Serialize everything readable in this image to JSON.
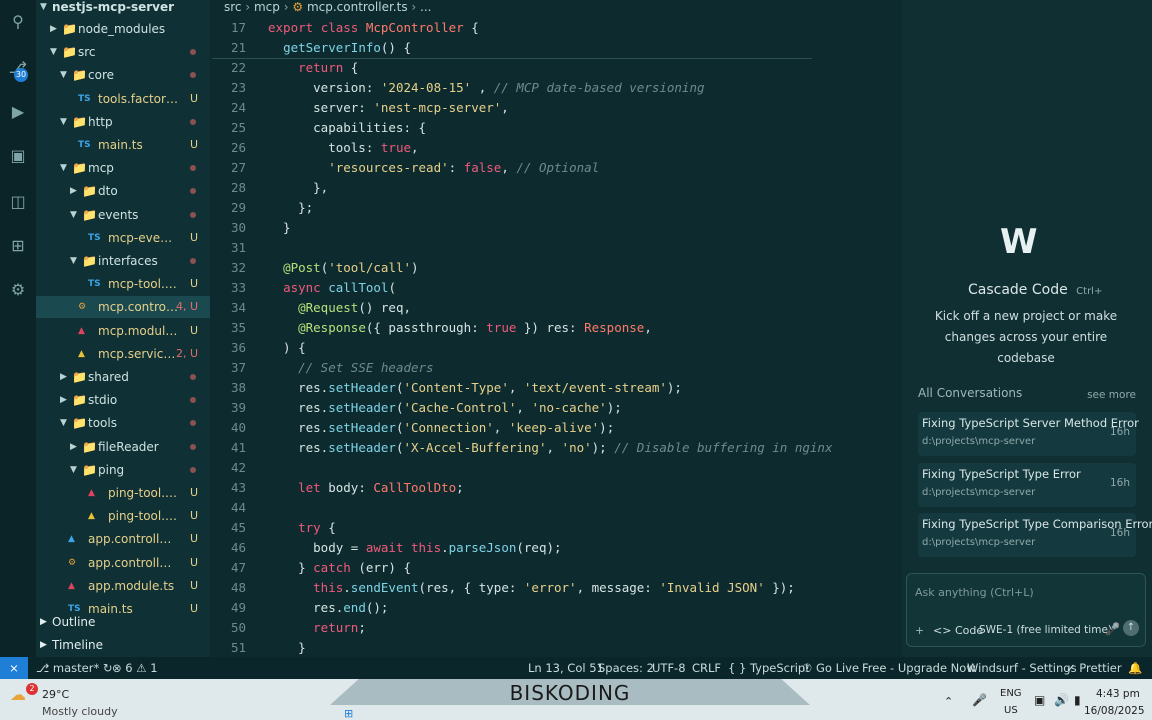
{
  "activity_bar": {
    "icons": [
      "search-icon",
      "source-control-icon",
      "run-debug-icon",
      "extensions-icon",
      "remote-explorer-icon",
      "testing-icon",
      "windsurf-icon"
    ],
    "scm_badge": "30"
  },
  "explorer": {
    "root": "nestjs-mcp-server",
    "items": [
      {
        "label": "node_modules",
        "depth": 1,
        "kind": "folder",
        "open": false,
        "status": ""
      },
      {
        "label": "src",
        "depth": 1,
        "kind": "folder",
        "open": true,
        "status": "dot"
      },
      {
        "label": "core",
        "depth": 2,
        "kind": "folder",
        "open": true,
        "status": "dot"
      },
      {
        "label": "tools.factory.ts",
        "depth": 3,
        "kind": "ts",
        "status": "U"
      },
      {
        "label": "http",
        "depth": 2,
        "kind": "folder",
        "open": true,
        "status": "dot"
      },
      {
        "label": "main.ts",
        "depth": 3,
        "kind": "ts",
        "status": "U"
      },
      {
        "label": "mcp",
        "depth": 2,
        "kind": "folder",
        "open": true,
        "status": "dot"
      },
      {
        "label": "dto",
        "depth": 3,
        "kind": "folder",
        "open": false,
        "status": "dot"
      },
      {
        "label": "events",
        "depth": 3,
        "kind": "folder",
        "open": true,
        "status": "dot"
      },
      {
        "label": "mcp-event.ts",
        "depth": 4,
        "kind": "ts",
        "status": "U"
      },
      {
        "label": "interfaces",
        "depth": 3,
        "kind": "folder",
        "open": true,
        "status": "dot"
      },
      {
        "label": "mcp-tool.interf...",
        "depth": 4,
        "kind": "ts",
        "status": "U"
      },
      {
        "label": "mcp.controller...",
        "depth": 3,
        "kind": "controller",
        "status": "4, U",
        "active": true
      },
      {
        "label": "mcp.module.ts",
        "depth": 3,
        "kind": "module",
        "status": "U"
      },
      {
        "label": "mcp.service.ts",
        "depth": 3,
        "kind": "service",
        "status": "2, U"
      },
      {
        "label": "shared",
        "depth": 2,
        "kind": "folder",
        "open": false,
        "status": "dot"
      },
      {
        "label": "stdio",
        "depth": 2,
        "kind": "folder",
        "open": false,
        "status": "dot"
      },
      {
        "label": "tools",
        "depth": 2,
        "kind": "folder",
        "open": true,
        "status": "dot"
      },
      {
        "label": "fileReader",
        "depth": 3,
        "kind": "folder",
        "open": false,
        "status": "dot"
      },
      {
        "label": "ping",
        "depth": 3,
        "kind": "folder",
        "open": true,
        "status": "dot"
      },
      {
        "label": "ping-tool.mod...",
        "depth": 4,
        "kind": "module",
        "status": "U"
      },
      {
        "label": "ping-tool.servic...",
        "depth": 4,
        "kind": "service",
        "status": "U"
      },
      {
        "label": "app.controller.spe...",
        "depth": 2,
        "kind": "test",
        "status": "U"
      },
      {
        "label": "app.controller.ts",
        "depth": 2,
        "kind": "controller",
        "status": "U"
      },
      {
        "label": "app.module.ts",
        "depth": 2,
        "kind": "module",
        "status": "U"
      },
      {
        "label": "main.ts",
        "depth": 2,
        "kind": "ts",
        "status": "U"
      }
    ],
    "outline": "Outline",
    "timeline": "Timeline"
  },
  "editor": {
    "breadcrumb": [
      "src",
      "mcp",
      "mcp.controller.ts",
      "..."
    ],
    "lines": [
      {
        "n": "17",
        "tokens": [
          [
            "k",
            "export "
          ],
          [
            "k",
            "class "
          ],
          [
            "t",
            "McpController "
          ],
          [
            "",
            "{"
          ]
        ]
      },
      {
        "n": "21",
        "tokens": [
          [
            "",
            "  "
          ],
          [
            "f",
            "getServerInfo"
          ],
          [
            "",
            "() {"
          ]
        ]
      },
      {
        "n": "22",
        "tokens": [
          [
            "",
            "    "
          ],
          [
            "k",
            "return "
          ],
          [
            "",
            "{"
          ]
        ]
      },
      {
        "n": "23",
        "tokens": [
          [
            "",
            "      version: "
          ],
          [
            "s",
            "'2024-08-15'"
          ],
          [
            "",
            " , "
          ],
          [
            "c",
            "// MCP date-based versioning"
          ]
        ]
      },
      {
        "n": "24",
        "tokens": [
          [
            "",
            "      server: "
          ],
          [
            "s",
            "'nest-mcp-server'"
          ],
          [
            "",
            ","
          ]
        ]
      },
      {
        "n": "25",
        "tokens": [
          [
            "",
            "      capabilities: {"
          ]
        ]
      },
      {
        "n": "26",
        "tokens": [
          [
            "",
            "        tools: "
          ],
          [
            "k",
            "true"
          ],
          [
            "",
            ","
          ]
        ]
      },
      {
        "n": "27",
        "tokens": [
          [
            "",
            "        "
          ],
          [
            "s",
            "'resources-read'"
          ],
          [
            "",
            ": "
          ],
          [
            "k",
            "false"
          ],
          [
            "",
            ", "
          ],
          [
            "c",
            "// Optional"
          ]
        ]
      },
      {
        "n": "28",
        "tokens": [
          [
            "",
            "      },"
          ]
        ]
      },
      {
        "n": "29",
        "tokens": [
          [
            "",
            "    };"
          ]
        ]
      },
      {
        "n": "30",
        "tokens": [
          [
            "",
            "  }"
          ]
        ]
      },
      {
        "n": "31",
        "tokens": []
      },
      {
        "n": "32",
        "tokens": [
          [
            "",
            "  "
          ],
          [
            "d",
            "@Post"
          ],
          [
            "",
            "("
          ],
          [
            "s",
            "'tool/call'"
          ],
          [
            "",
            ")"
          ]
        ]
      },
      {
        "n": "33",
        "tokens": [
          [
            "",
            "  "
          ],
          [
            "k",
            "async "
          ],
          [
            "f",
            "callTool"
          ],
          [
            "",
            "("
          ]
        ]
      },
      {
        "n": "34",
        "tokens": [
          [
            "",
            "    "
          ],
          [
            "d",
            "@Request"
          ],
          [
            "",
            "() req,"
          ]
        ]
      },
      {
        "n": "35",
        "tokens": [
          [
            "",
            "    "
          ],
          [
            "d",
            "@Response"
          ],
          [
            "",
            "({ passthrough: "
          ],
          [
            "k",
            "true"
          ],
          [
            "",
            " }) res: "
          ],
          [
            "t",
            "Response"
          ],
          [
            "",
            ","
          ]
        ]
      },
      {
        "n": "36",
        "tokens": [
          [
            "",
            "  ) {"
          ]
        ]
      },
      {
        "n": "37",
        "tokens": [
          [
            "",
            "    "
          ],
          [
            "c",
            "// Set SSE headers"
          ]
        ]
      },
      {
        "n": "38",
        "tokens": [
          [
            "",
            "    res."
          ],
          [
            "f",
            "setHeader"
          ],
          [
            "",
            "("
          ],
          [
            "s",
            "'Content-Type'"
          ],
          [
            "",
            ", "
          ],
          [
            "s",
            "'text/event-stream'"
          ],
          [
            "",
            ");"
          ]
        ]
      },
      {
        "n": "39",
        "tokens": [
          [
            "",
            "    res."
          ],
          [
            "f",
            "setHeader"
          ],
          [
            "",
            "("
          ],
          [
            "s",
            "'Cache-Control'"
          ],
          [
            "",
            ", "
          ],
          [
            "s",
            "'no-cache'"
          ],
          [
            "",
            ");"
          ]
        ]
      },
      {
        "n": "40",
        "tokens": [
          [
            "",
            "    res."
          ],
          [
            "f",
            "setHeader"
          ],
          [
            "",
            "("
          ],
          [
            "s",
            "'Connection'"
          ],
          [
            "",
            ", "
          ],
          [
            "s",
            "'keep-alive'"
          ],
          [
            "",
            ");"
          ]
        ]
      },
      {
        "n": "41",
        "tokens": [
          [
            "",
            "    res."
          ],
          [
            "f",
            "setHeader"
          ],
          [
            "",
            "("
          ],
          [
            "s",
            "'X-Accel-Buffering'"
          ],
          [
            "",
            ", "
          ],
          [
            "s",
            "'no'"
          ],
          [
            "",
            "); "
          ],
          [
            "c",
            "// Disable buffering in nginx"
          ]
        ]
      },
      {
        "n": "42",
        "tokens": []
      },
      {
        "n": "43",
        "tokens": [
          [
            "",
            "    "
          ],
          [
            "k",
            "let "
          ],
          [
            "",
            "body: "
          ],
          [
            "t",
            "CallToolDto"
          ],
          [
            "",
            ";"
          ]
        ]
      },
      {
        "n": "44",
        "tokens": []
      },
      {
        "n": "45",
        "tokens": [
          [
            "",
            "    "
          ],
          [
            "k",
            "try "
          ],
          [
            "",
            "{"
          ]
        ]
      },
      {
        "n": "46",
        "tokens": [
          [
            "",
            "      body = "
          ],
          [
            "k",
            "await "
          ],
          [
            "k",
            "this"
          ],
          [
            "",
            "."
          ],
          [
            "f",
            "parseJson"
          ],
          [
            "",
            "(req);"
          ]
        ]
      },
      {
        "n": "47",
        "tokens": [
          [
            "",
            "    } "
          ],
          [
            "k",
            "catch "
          ],
          [
            "",
            "(err) {"
          ]
        ]
      },
      {
        "n": "48",
        "tokens": [
          [
            "",
            "      "
          ],
          [
            "k",
            "this"
          ],
          [
            "",
            "."
          ],
          [
            "f",
            "sendEvent"
          ],
          [
            "",
            "(res, { type: "
          ],
          [
            "s",
            "'error'"
          ],
          [
            "",
            ", message: "
          ],
          [
            "s",
            "'Invalid JSON'"
          ],
          [
            "",
            " });"
          ]
        ]
      },
      {
        "n": "49",
        "tokens": [
          [
            "",
            "      res."
          ],
          [
            "f",
            "end"
          ],
          [
            "",
            "();"
          ]
        ]
      },
      {
        "n": "50",
        "tokens": [
          [
            "",
            "      "
          ],
          [
            "k",
            "return"
          ],
          [
            "",
            ";"
          ]
        ]
      },
      {
        "n": "51",
        "tokens": [
          [
            "",
            "    }"
          ]
        ]
      }
    ]
  },
  "cascade": {
    "title": "Cascade Code",
    "shortcut": "Ctrl+",
    "tagline": "Kick off a new project or make changes across your entire codebase",
    "all_conversations": "All Conversations",
    "see_more": "see more",
    "conversations": [
      {
        "title": "Fixing TypeScript Server Method Error",
        "path": "d:\\projects\\mcp-server",
        "time": "16h"
      },
      {
        "title": "Fixing TypeScript Type Error",
        "path": "d:\\projects\\mcp-server",
        "time": "16h"
      },
      {
        "title": "Fixing TypeScript Type Comparison Error",
        "path": "d:\\projects\\mcp-server",
        "time": "16h"
      }
    ],
    "input_placeholder": "Ask anything (Ctrl+L)",
    "mode": "Code",
    "model": "SWE-1 (free limited time)"
  },
  "statusbar": {
    "branch": "master*",
    "errors": "6",
    "warnings": "1",
    "position": "Ln 13, Col 51",
    "spaces": "Spaces: 2",
    "encoding": "UTF-8",
    "eol": "CRLF",
    "language": "TypeScript",
    "golive": "Go Live",
    "upgrade": "Free - Upgrade Now",
    "windsurf": "Windsurf - Settings",
    "prettier": "Prettier"
  },
  "taskbar": {
    "weather_temp": "29°C",
    "weather_desc": "Mostly cloudy",
    "weather_badge": "2",
    "banner": "BISKODING",
    "lang_top": "ENG",
    "lang_bottom": "US",
    "time": "4:43 pm",
    "date": "16/08/2025"
  },
  "colors": {
    "accent": "#1f7fd6",
    "brand": "#0d2b2f"
  }
}
